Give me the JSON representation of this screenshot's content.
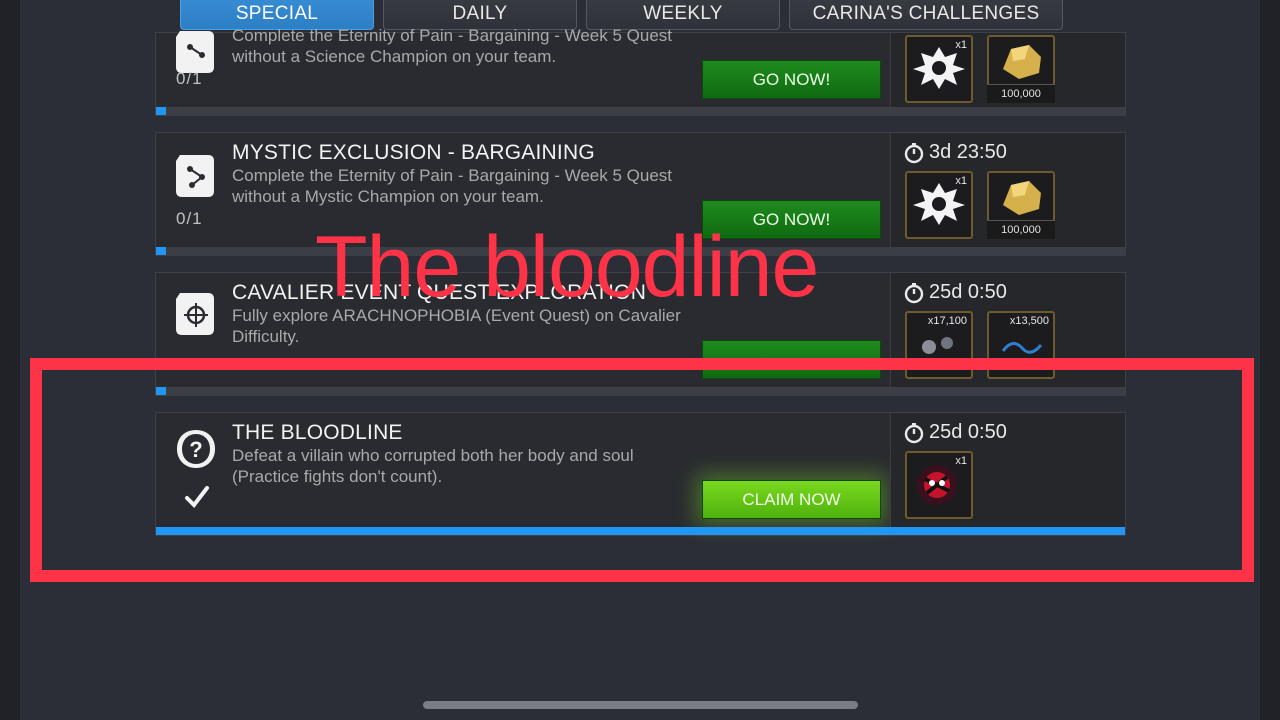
{
  "tabs": [
    {
      "label": "SPECIAL",
      "active": true
    },
    {
      "label": "DAILY",
      "active": false
    },
    {
      "label": "WEEKLY",
      "active": false
    },
    {
      "label": "CARINA'S CHALLENGES",
      "active": false
    }
  ],
  "quests": [
    {
      "title": "",
      "description": "Complete the Eternity of Pain - Bargaining - Week 5 Quest without a Science Champion on your team.",
      "progress_text": "0/1",
      "progress_fraction": 0,
      "button": "GO NOW!",
      "timer": "",
      "rewards": [
        {
          "icon": "crystal-icon",
          "qty": "x1",
          "amount": ""
        },
        {
          "icon": "gold-icon",
          "qty": "",
          "amount": "100,000"
        }
      ]
    },
    {
      "title": "MYSTIC EXCLUSION - BARGAINING",
      "description": "Complete the Eternity of Pain - Bargaining - Week 5 Quest without a Mystic Champion on your team.",
      "progress_text": "0/1",
      "progress_fraction": 0,
      "button": "GO NOW!",
      "timer": "3d 23:50",
      "rewards": [
        {
          "icon": "crystal-icon",
          "qty": "x1",
          "amount": ""
        },
        {
          "icon": "gold-icon",
          "qty": "",
          "amount": "100,000"
        }
      ]
    },
    {
      "title": "CAVALIER EVENT QUEST EXPLORATION",
      "description": "Fully explore ARACHNOPHOBIA (Event Quest) on Cavalier Difficulty.",
      "progress_text": "",
      "progress_fraction": 0,
      "button": "",
      "timer": "25d 0:50",
      "rewards": [
        {
          "icon": "catalyst-icon",
          "qty": "x17,100",
          "amount": ""
        },
        {
          "icon": "shard-icon",
          "qty": "x13,500",
          "amount": ""
        }
      ]
    },
    {
      "title": "THE BLOODLINE",
      "description": "Defeat a villain who corrupted both her body and soul (Practice fights don't count).",
      "progress_text": "",
      "progress_fraction": 1,
      "button": "CLAIM NOW",
      "timer": "25d 0:50",
      "rewards": [
        {
          "icon": "champion-crystal-icon",
          "qty": "x1",
          "amount": ""
        }
      ]
    }
  ],
  "overlay": {
    "title": "The bloodline",
    "highlight_color": "#ff3347"
  },
  "colors": {
    "progress": "#2196f3",
    "go_button": "#1f8a1f",
    "claim_button": "#7ad81e"
  }
}
